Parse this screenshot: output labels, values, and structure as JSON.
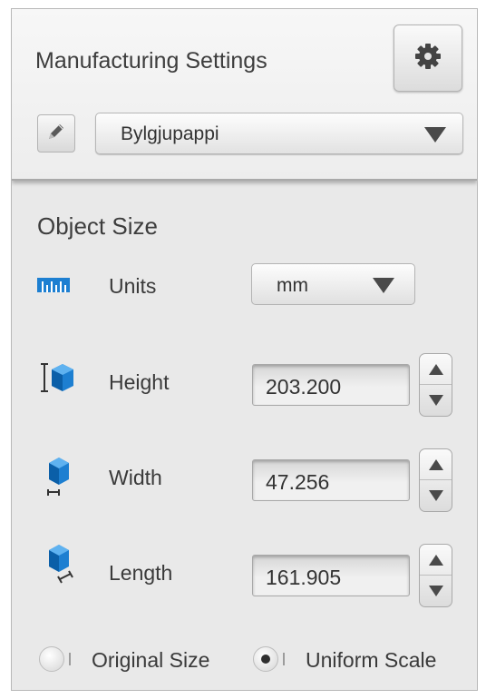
{
  "header": {
    "title": "Manufacturing Settings",
    "settings_icon": "gear-icon",
    "edit_icon": "pencil-icon",
    "profile": {
      "selected": "Bylgjupappi"
    }
  },
  "object_size": {
    "title": "Object Size",
    "units": {
      "label": "Units",
      "icon": "ruler-icon",
      "selected": "mm"
    },
    "height": {
      "label": "Height",
      "icon": "height-cube-icon",
      "value": "203.200"
    },
    "width": {
      "label": "Width",
      "icon": "width-cube-icon",
      "value": "47.256"
    },
    "length": {
      "label": "Length",
      "icon": "length-cube-icon",
      "value": "161.905"
    }
  },
  "scale_mode": {
    "options": [
      {
        "label": "Original Size",
        "selected": false
      },
      {
        "label": "Uniform Scale",
        "selected": true
      }
    ]
  },
  "colors": {
    "accent_blue": "#1d7fd1",
    "background": "#e9e9e9"
  }
}
